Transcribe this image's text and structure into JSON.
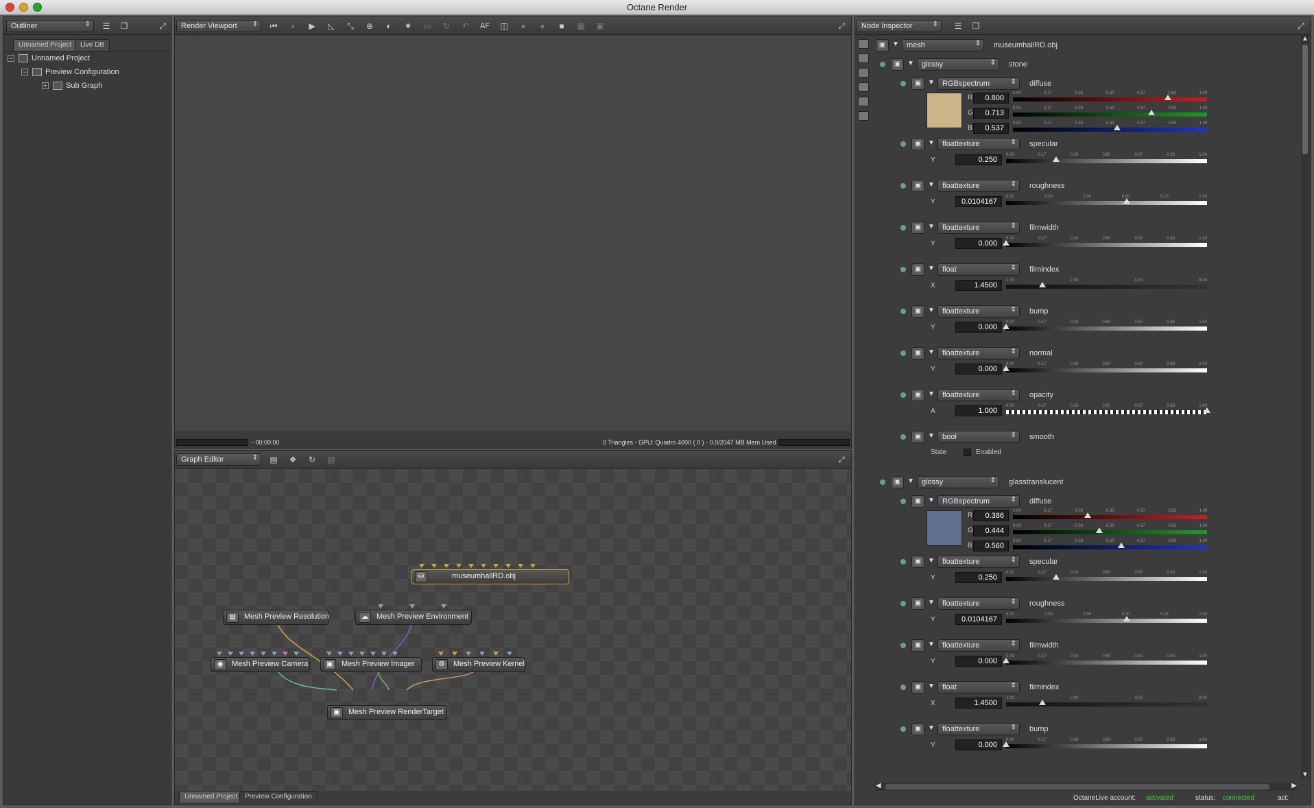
{
  "window": {
    "title": "Octane Render"
  },
  "outliner": {
    "dropdown": "Outliner",
    "tabs": [
      "Unnamed Project",
      "Live DB"
    ],
    "tree": [
      {
        "label": "Unnamed Project",
        "expander": "−"
      },
      {
        "label": "Preview Configuration",
        "expander": "−"
      },
      {
        "label": "Sub Graph",
        "expander": "+"
      }
    ]
  },
  "render_viewport": {
    "dropdown": "Render Viewport",
    "af_label": "AF",
    "status_time": "- 00:00:00",
    "status_info": "0 Triangles - GPU: Quadro 4000 ( 0 ) - 0.0/2047 MB Mem Used"
  },
  "graph_editor": {
    "dropdown": "Graph Editor",
    "nodes": {
      "mesh": "museumhallRD.obj",
      "resolution": "Mesh Preview Resolution",
      "environment": "Mesh Preview Environment",
      "camera": "Mesh Preview Camera",
      "imager": "Mesh Preview Imager",
      "kernel": "Mesh Preview Kernel",
      "render_target": "Mesh Preview RenderTarget"
    },
    "bottom_tabs": [
      "Unnamed Project",
      "Preview Configuration"
    ]
  },
  "inspector": {
    "dropdown": "Node Inspector",
    "mesh": {
      "type": "mesh",
      "name": "museumhallRD.obj"
    },
    "tick_labels": {
      "t6": [
        "0.00",
        "0.17",
        "0.33",
        "0.50",
        "0.67",
        "0.83",
        "1.00"
      ],
      "rough": [
        "0.00",
        "0.00",
        "0.00",
        "0.00",
        "0.15",
        "1.00"
      ],
      "filmindex": [
        "1.00",
        "2.00",
        "4.00",
        "8.00"
      ]
    },
    "materials": [
      {
        "type": "glossy",
        "name": "stone",
        "diffuse": {
          "type": "RGBspectrum",
          "name": "diffuse",
          "r": "0.800",
          "g": "0.713",
          "b": "0.537",
          "color": "#ccb488"
        },
        "specular": {
          "type": "floattexture",
          "name": "specular",
          "axis": "Y",
          "value": "0.250",
          "frac": 0.25
        },
        "roughness": {
          "type": "floattexture",
          "name": "roughness",
          "axis": "Y",
          "value": "0.0104167",
          "frac": 0.6
        },
        "filmwidth": {
          "type": "floattexture",
          "name": "filmwidth",
          "axis": "Y",
          "value": "0.000",
          "frac": 0.0
        },
        "filmindex": {
          "type": "float",
          "name": "filmindex",
          "axis": "X",
          "value": "1.4500",
          "frac": 0.18
        },
        "bump": {
          "type": "floattexture",
          "name": "bump",
          "axis": "Y",
          "value": "0.000",
          "frac": 0.0
        },
        "normal": {
          "type": "floattexture",
          "name": "normal",
          "axis": "Y",
          "value": "0.000",
          "frac": 0.0
        },
        "opacity": {
          "type": "floattexture",
          "name": "opacity",
          "axis": "A",
          "value": "1.000",
          "frac": 1.0
        },
        "smooth": {
          "type": "bool",
          "name": "smooth",
          "state_label": "State",
          "enabled_label": "Enabled"
        }
      },
      {
        "type": "glossy",
        "name": "glasstranslucent",
        "diffuse": {
          "type": "RGBspectrum",
          "name": "diffuse",
          "r": "0.386",
          "g": "0.444",
          "b": "0.560",
          "color": "#62718f"
        },
        "specular": {
          "type": "floattexture",
          "name": "specular",
          "axis": "Y",
          "value": "0.250",
          "frac": 0.25
        },
        "roughness": {
          "type": "floattexture",
          "name": "roughness",
          "axis": "Y",
          "value": "0.0104167",
          "frac": 0.6
        },
        "filmwidth": {
          "type": "floattexture",
          "name": "filmwidth",
          "axis": "Y",
          "value": "0.000",
          "frac": 0.0
        },
        "filmindex": {
          "type": "float",
          "name": "filmindex",
          "axis": "X",
          "value": "1.4500",
          "frac": 0.18
        },
        "bump": {
          "type": "floattexture",
          "name": "bump",
          "axis": "Y",
          "value": "0.000",
          "frac": 0.0
        }
      }
    ]
  },
  "footer": {
    "account_label": "OctaneLive account:",
    "account_value": "activated",
    "status_label": "status:",
    "status_value": "connected",
    "act_label": "act:"
  },
  "colors": {
    "accent_green": "#3fcf3f",
    "panel_bg": "#3c3c3c"
  }
}
